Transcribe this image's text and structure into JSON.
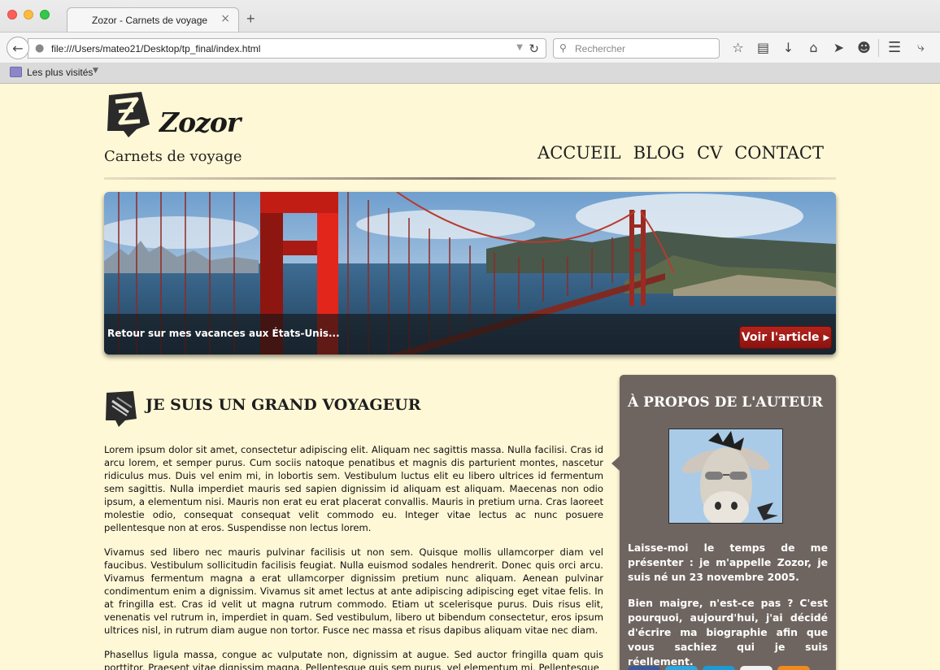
{
  "browser": {
    "tab_title": "Zozor - Carnets de voyage",
    "tab_close": "×",
    "new_tab": "+",
    "url": "file:///Users/mateo21/Desktop/tp_final/index.html",
    "search_placeholder": "Rechercher",
    "bookmarks_label": "Les plus visités"
  },
  "header": {
    "logo_text": "Zozor",
    "tagline": "Carnets de voyage",
    "nav": [
      "ACCUEIL",
      "BLOG",
      "CV",
      "CONTACT"
    ]
  },
  "banner": {
    "caption": "Retour sur mes vacances aux États-Unis...",
    "button_label": "Voir l'article"
  },
  "article": {
    "title": "JE SUIS UN GRAND VOYAGEUR",
    "paragraphs": [
      "Lorem ipsum dolor sit amet, consectetur adipiscing elit. Aliquam nec sagittis massa. Nulla facilisi. Cras id arcu lorem, et semper purus. Cum sociis natoque penatibus et magnis dis parturient montes, nascetur ridiculus mus. Duis vel enim mi, in lobortis sem. Vestibulum luctus elit eu libero ultrices id fermentum sem sagittis. Nulla imperdiet mauris sed sapien dignissim id aliquam est aliquam. Maecenas non odio ipsum, a elementum nisi. Mauris non erat eu erat placerat convallis. Mauris in pretium urna. Cras laoreet molestie odio, consequat consequat velit commodo eu. Integer vitae lectus ac nunc posuere pellentesque non at eros. Suspendisse non lectus lorem.",
      "Vivamus sed libero nec mauris pulvinar facilisis ut non sem. Quisque mollis ullamcorper diam vel faucibus. Vestibulum sollicitudin facilisis feugiat. Nulla euismod sodales hendrerit. Donec quis orci arcu. Vivamus fermentum magna a erat ullamcorper dignissim pretium nunc aliquam. Aenean pulvinar condimentum enim a dignissim. Vivamus sit amet lectus at ante adipiscing adipiscing eget vitae felis. In at fringilla est. Cras id velit ut magna rutrum commodo. Etiam ut scelerisque purus. Duis risus elit, venenatis vel rutrum in, imperdiet in quam. Sed vestibulum, libero ut bibendum consectetur, eros ipsum ultrices nisl, in rutrum diam augue non tortor. Fusce nec massa et risus dapibus aliquam vitae nec diam.",
      "Phasellus ligula massa, congue ac vulputate non, dignissim at augue. Sed auctor fringilla quam quis porttitor. Praesent vitae dignissim magna. Pellentesque quis sem purus, vel elementum mi. Pellentesque"
    ]
  },
  "aside": {
    "title": "À PROPOS DE L'AUTEUR",
    "paragraphs": [
      "Laisse-moi le temps de me présenter : je m'appelle Zozor, je suis né un 23 novembre 2005.",
      "Bien maigre, n'est-ce pas ? C'est pourquoi, aujourd'hui, j'ai décidé d'écrire ma biographie afin que vous sachiez qui je suis réellement."
    ]
  },
  "icons": {
    "back": "back-arrow-icon",
    "reload": "reload-icon",
    "search": "search-icon",
    "logo": "zozor-logo-icon",
    "article": "pen-badge-icon"
  },
  "colors": {
    "page_bg": "#fff8d6",
    "aside_bg": "#6f6560",
    "button_red": "#a11c17"
  }
}
